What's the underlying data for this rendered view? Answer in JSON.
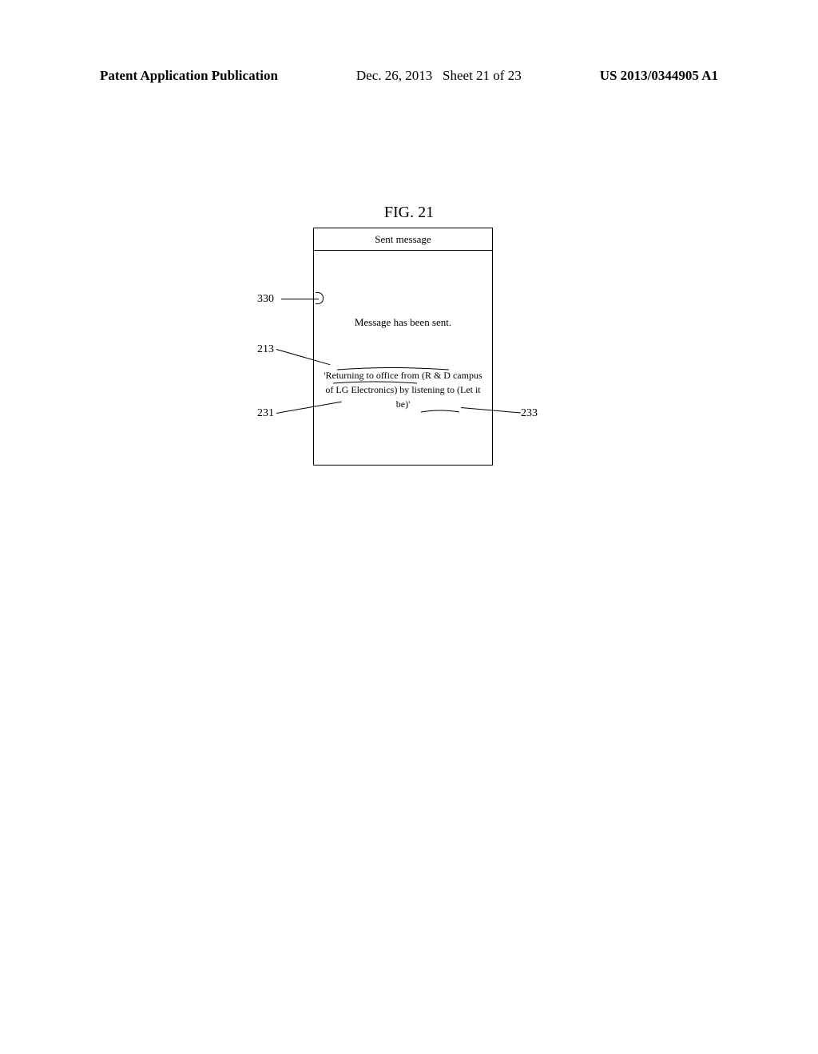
{
  "header": {
    "left": "Patent Application Publication",
    "date": "Dec. 26, 2013",
    "sheet": "Sheet 21 of 23",
    "pubno": "US 2013/0344905 A1"
  },
  "figure": {
    "label": "FIG. 21",
    "title": "Sent message",
    "line1": "Message has been sent.",
    "line2": "'Returning to office from (R & D campus of LG Electronics) by listening to (Let it be)'",
    "refs": {
      "r330": "330",
      "r213": "213",
      "r231": "231",
      "r233": "233"
    }
  }
}
